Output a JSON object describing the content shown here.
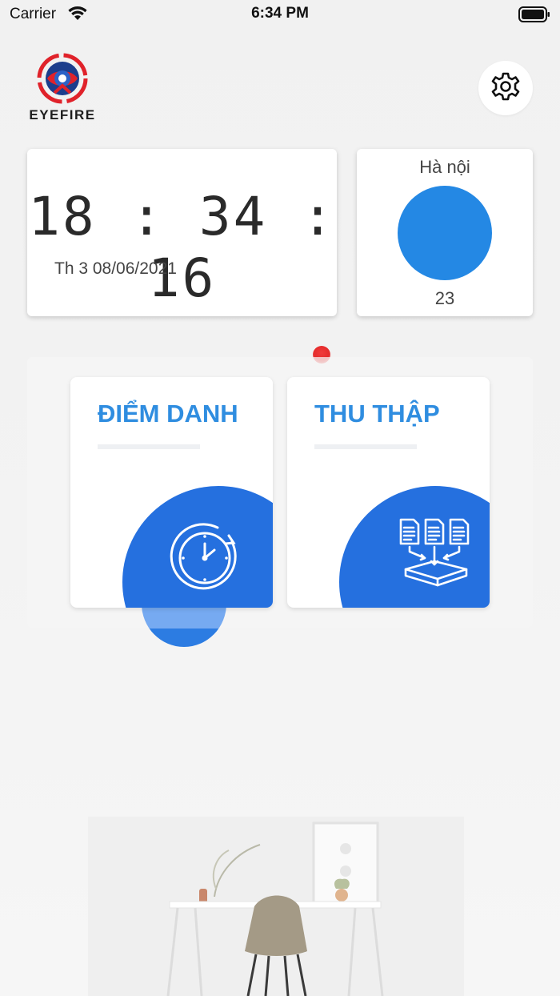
{
  "status_bar": {
    "carrier": "Carrier",
    "time": "6:34 PM"
  },
  "header": {
    "logo_text": "EYEFIRE"
  },
  "clock": {
    "time": "18:34:16",
    "date": "Th 3 08/06/2021"
  },
  "weather": {
    "city": "Hà nội",
    "temperature": "23"
  },
  "tiles": [
    {
      "title": "ĐIỂM DANH",
      "icon": "clock-history-icon"
    },
    {
      "title": "THU THẬP",
      "icon": "documents-collect-icon"
    }
  ],
  "colors": {
    "accent_blue": "#2570df",
    "title_blue": "#2f8de0",
    "weather_blue": "#2488e4",
    "logo_red": "#e0222a"
  }
}
